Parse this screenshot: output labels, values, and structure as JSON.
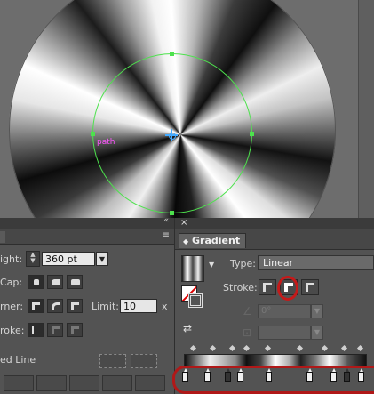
{
  "canvas": {
    "path_label": "path"
  },
  "stroke_panel": {
    "weight_label": "ight:",
    "weight_value": "360 pt",
    "cap_label": "Cap:",
    "corner_label": "rner:",
    "limit_label": "Limit:",
    "limit_value": "10",
    "limit_unit": "x",
    "align_label": "roke:",
    "dashed_line_label": "ed Line",
    "menu_icon": "≡",
    "collapse_icon": "«"
  },
  "gradient_panel": {
    "tab_label": "Gradient",
    "close_icon": "×",
    "type_label": "Type:",
    "type_value": "Linear",
    "stroke_label": "Stroke:",
    "angle_value": "0°",
    "highlight_color": "#c41a1a",
    "path_color": "#4de24d"
  }
}
